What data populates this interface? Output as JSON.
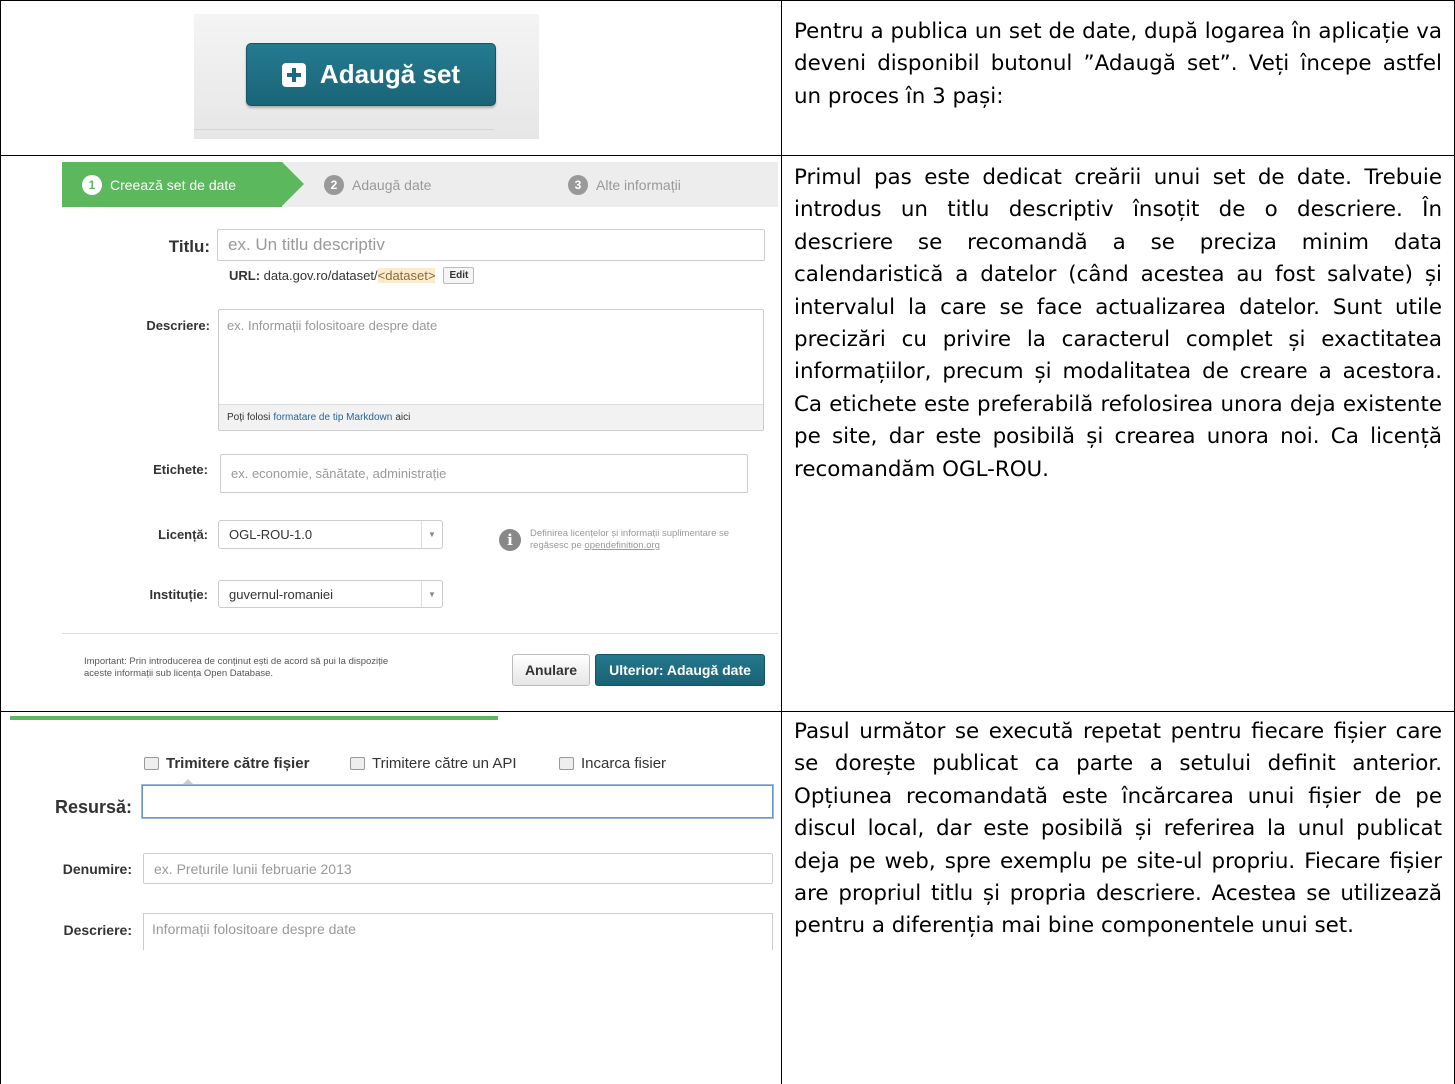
{
  "row1": {
    "button_label": "Adaugă set",
    "text": "Pentru a publica un set de date, după logarea în aplicație va deveni disponibil butonul ”Adaugă set”. Veți începe astfel un proces în 3 pași:"
  },
  "row2": {
    "stages": [
      {
        "num": "1",
        "label": "Creează set de date"
      },
      {
        "num": "2",
        "label": "Adaugă date"
      },
      {
        "num": "3",
        "label": "Alte informații"
      }
    ],
    "title_label": "Titlu:",
    "title_placeholder": "ex. Un titlu descriptiv",
    "url_label": "URL:",
    "url_prefix": "data.gov.ro/dataset/",
    "url_slug": "<dataset>",
    "edit_label": "Edit",
    "desc_label": "Descriere:",
    "desc_placeholder": "ex. Informații folositoare despre date",
    "markdown_pre": "Poți folosi",
    "markdown_link": "formatare de tip Markdown",
    "markdown_post": "aici",
    "tags_label": "Etichete:",
    "tags_placeholder": "ex. economie, sănătate, administrație",
    "license_label": "Licență:",
    "license_value": "OGL-ROU-1.0",
    "license_info_pre": "Definirea licențelor și informații suplimentare se regăsesc pe",
    "license_info_link": "opendefinition.org",
    "org_label": "Instituție:",
    "org_value": "guvernul-romaniei",
    "important_text": "Important: Prin introducerea de conținut ești de acord să pui la dispoziție aceste informații sub licența Open Database.",
    "cancel_label": "Anulare",
    "next_label": "Ulterior: Adaugă date",
    "text": "Primul pas este dedicat creării unui set de date. Trebuie introdus un titlu descriptiv însoțit de o descriere. În descriere se recomandă a se preciza minim data calendaristică a datelor (când acestea au fost salvate) și intervalul la care se face actualizarea datelor. Sunt utile precizări cu privire la caracterul complet și exactitatea informațiilor, precum și modalitatea de creare a acestora. Ca etichete este preferabilă refolosirea unora deja existente pe site, dar este posibilă și crearea unora noi. Ca licență recomandăm OGL-ROU."
  },
  "row3": {
    "tabs": [
      "Trimitere către fișier",
      "Trimitere către un API",
      "Incarca fisier"
    ],
    "resource_label": "Resursă:",
    "name_label": "Denumire:",
    "name_placeholder": "ex. Preturile lunii februarie 2013",
    "desc_label": "Descriere:",
    "desc_placeholder": "Informații folositoare despre date",
    "text": "Pasul următor se execută repetat pentru fiecare fișier care se dorește publicat ca parte a setului definit anterior. Opțiunea recomandată este încărcarea unui fișier de pe discul local, dar este posibilă și referirea la unul publicat deja pe web, spre exemplu pe site-ul propriu. Fiecare fișier are propriul titlu și propria descriere. Acestea se utilizează pentru a diferenția mai bine componentele unui set."
  },
  "colors": {
    "accent": "#5cb85c",
    "primary": "#1d6a7e",
    "link": "#2a6496"
  }
}
